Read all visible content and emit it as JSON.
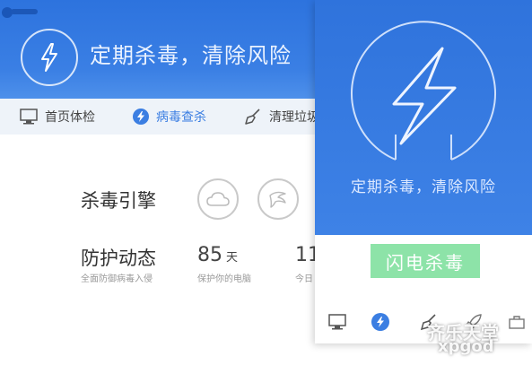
{
  "banner": {
    "title": "定期杀毒，清除风险"
  },
  "tabs": [
    {
      "label": "首页体检",
      "icon": "monitor-icon"
    },
    {
      "label": "病毒查杀",
      "icon": "lightning-icon",
      "active": true
    },
    {
      "label": "清理垃圾",
      "icon": "broom-icon"
    }
  ],
  "engine": {
    "label": "杀毒引擎",
    "icons": [
      "cloud-engine-icon",
      "eagle-engine-icon"
    ]
  },
  "protection": {
    "label": "防护动态",
    "sub": "全面防御病毒入侵",
    "stat1": {
      "value": "85",
      "unit": "天",
      "caption": "保护你的电脑"
    },
    "stat2": {
      "value": "11",
      "caption": "今日"
    }
  },
  "panel": {
    "tagline": "定期杀毒，清除风险",
    "button": "闪电杀毒",
    "footer_icons": [
      "monitor-icon",
      "lightning-icon",
      "broom-icon",
      "rocket-icon",
      "toolbox-icon"
    ]
  },
  "watermark": {
    "line1": "齐乐天堂",
    "line2": "xpgod"
  },
  "colors": {
    "brand_blue": "#3a7fe4",
    "button_green": "#8de3a8",
    "active_tab": "#3b7ee2"
  }
}
